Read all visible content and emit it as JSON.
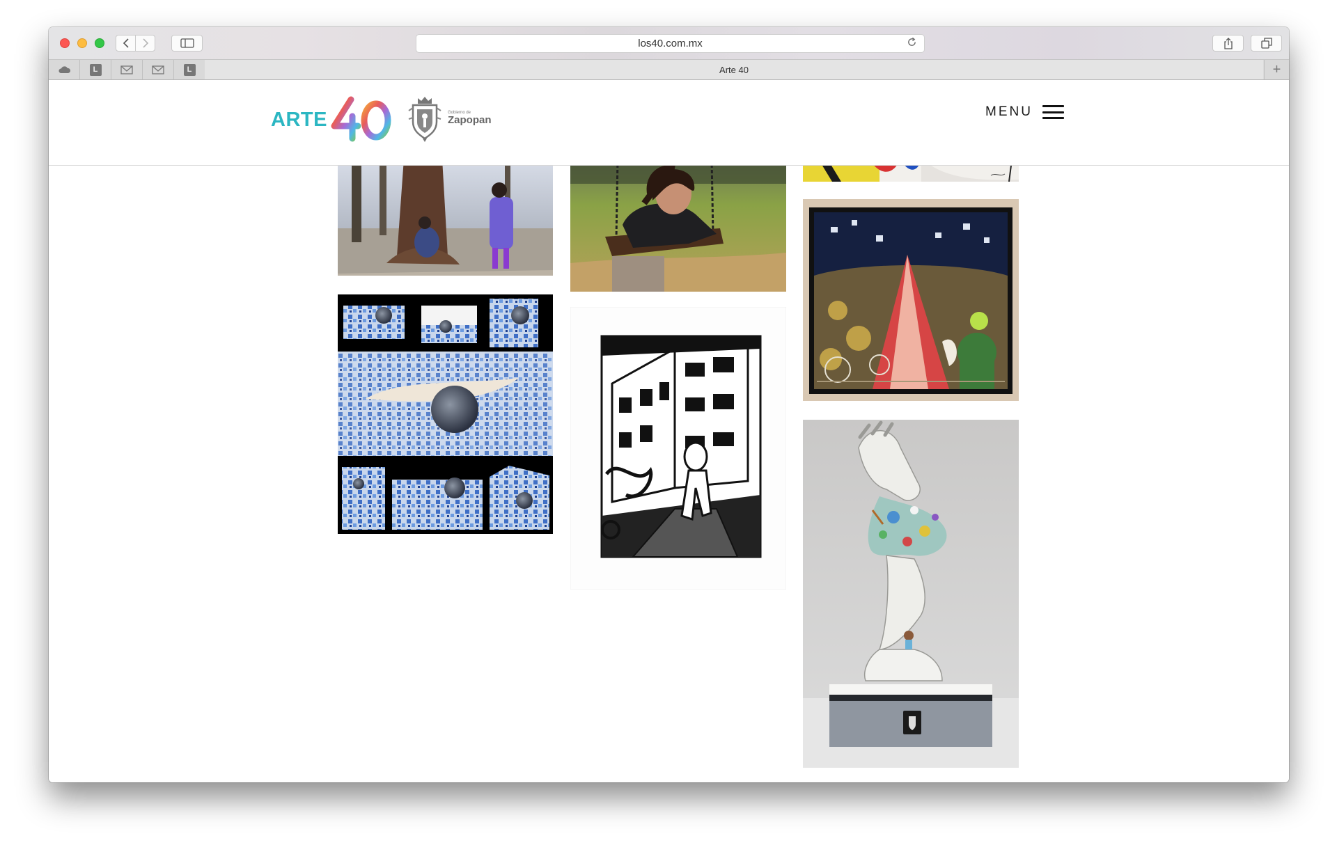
{
  "browser": {
    "url": "los40.com.mx",
    "tab_title": "Arte 40",
    "favorites": [
      "cloud",
      "L",
      "mail",
      "mail",
      "L"
    ]
  },
  "site": {
    "logo_text": "ARTE",
    "partner_small": "Gobierno de",
    "partner_name": "Zapopan",
    "menu_label": "MENU"
  },
  "gallery": [
    {
      "name": "children-under-tree"
    },
    {
      "name": "girl-on-swing"
    },
    {
      "name": "colorful-painting-top"
    },
    {
      "name": "night-road-painting"
    },
    {
      "name": "blue-puzzle-sphere"
    },
    {
      "name": "ink-comic-street"
    },
    {
      "name": "hand-sculpture"
    }
  ],
  "colors": {
    "arte_teal": "#2bb6c2",
    "menu_text": "#1a1a1a"
  }
}
